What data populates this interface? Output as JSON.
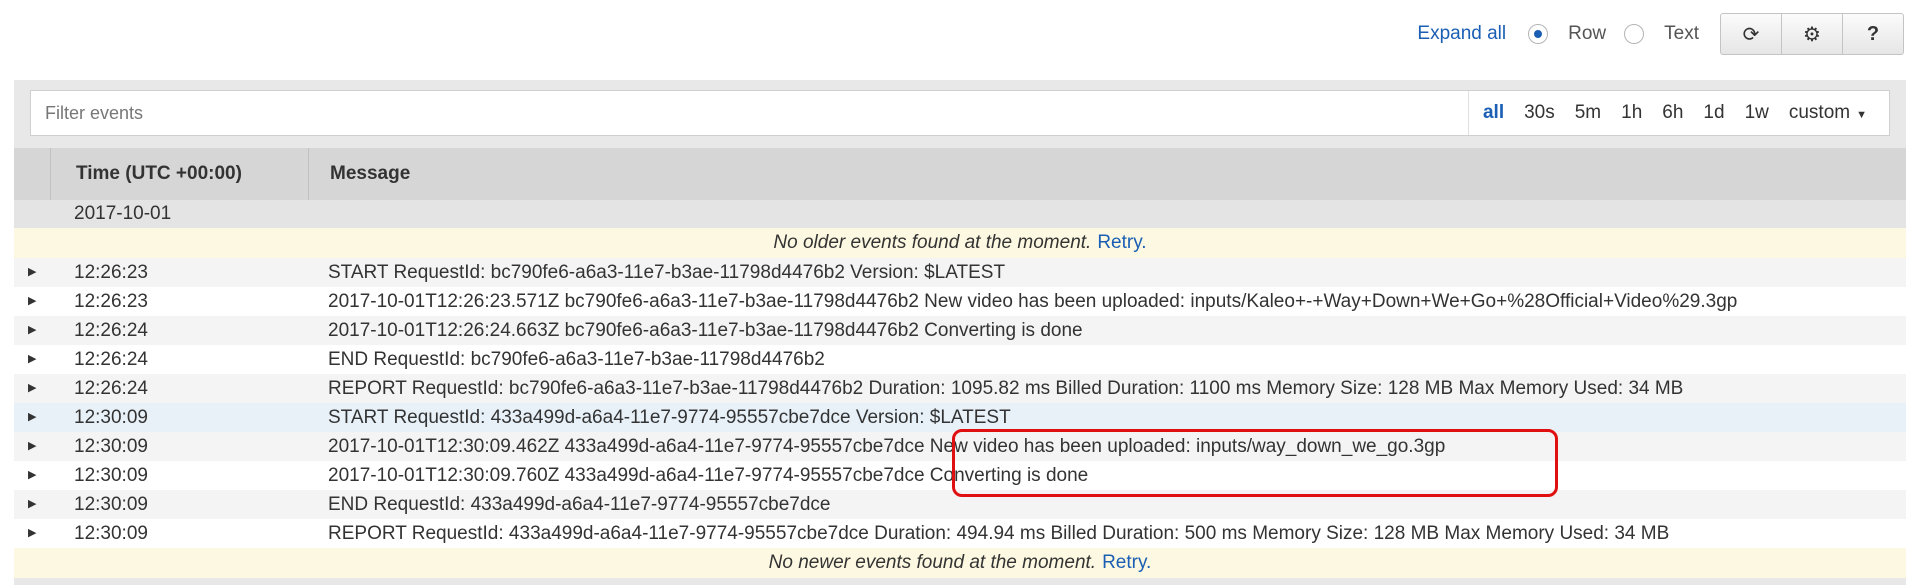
{
  "toolbar": {
    "expand_all": "Expand all",
    "view_modes": [
      {
        "label": "Row",
        "selected": true
      },
      {
        "label": "Text",
        "selected": false
      }
    ],
    "icons": [
      "refresh-icon",
      "gear-icon",
      "help-icon"
    ],
    "icon_glyphs": [
      "⟳",
      "⚙",
      "?"
    ]
  },
  "filter": {
    "placeholder": "Filter events",
    "ranges": [
      "all",
      "30s",
      "5m",
      "1h",
      "6h",
      "1d",
      "1w",
      "custom"
    ],
    "active_range": "all"
  },
  "table": {
    "headers": [
      "Time (UTC +00:00)",
      "Message"
    ],
    "date": "2017-10-01",
    "older_notice": "No older events found at the moment.",
    "newer_notice": "No newer events found at the moment.",
    "retry_label": "Retry.",
    "rows": [
      {
        "time": "12:26:23",
        "message": "START RequestId: bc790fe6-a6a3-11e7-b3ae-11798d4476b2 Version: $LATEST"
      },
      {
        "time": "12:26:23",
        "message": "2017-10-01T12:26:23.571Z bc790fe6-a6a3-11e7-b3ae-11798d4476b2 New video has been uploaded: inputs/Kaleo+-+Way+Down+We+Go+%28Official+Video%29.3gp"
      },
      {
        "time": "12:26:24",
        "message": "2017-10-01T12:26:24.663Z bc790fe6-a6a3-11e7-b3ae-11798d4476b2 Converting is done"
      },
      {
        "time": "12:26:24",
        "message": "END RequestId: bc790fe6-a6a3-11e7-b3ae-11798d4476b2"
      },
      {
        "time": "12:26:24",
        "message": "REPORT RequestId: bc790fe6-a6a3-11e7-b3ae-11798d4476b2 Duration: 1095.82 ms Billed Duration: 1100 ms Memory Size: 128 MB Max Memory Used: 34 MB"
      },
      {
        "time": "12:30:09",
        "message": "START RequestId: 433a499d-a6a4-11e7-9774-95557cbe7dce Version: $LATEST"
      },
      {
        "time": "12:30:09",
        "message": "2017-10-01T12:30:09.462Z 433a499d-a6a4-11e7-9774-95557cbe7dce New video has been uploaded: inputs/way_down_we_go.3gp"
      },
      {
        "time": "12:30:09",
        "message": "2017-10-01T12:30:09.760Z 433a499d-a6a4-11e7-9774-95557cbe7dce Converting is done"
      },
      {
        "time": "12:30:09",
        "message": "END RequestId: 433a499d-a6a4-11e7-9774-95557cbe7dce"
      },
      {
        "time": "12:30:09",
        "message": "REPORT RequestId: 433a499d-a6a4-11e7-9774-95557cbe7dce Duration: 494.94 ms Billed Duration: 500 ms Memory Size: 128 MB Max Memory Used: 34 MB"
      }
    ]
  },
  "colors": {
    "accent": "#1a5fb4",
    "highlight": "#e01010"
  }
}
